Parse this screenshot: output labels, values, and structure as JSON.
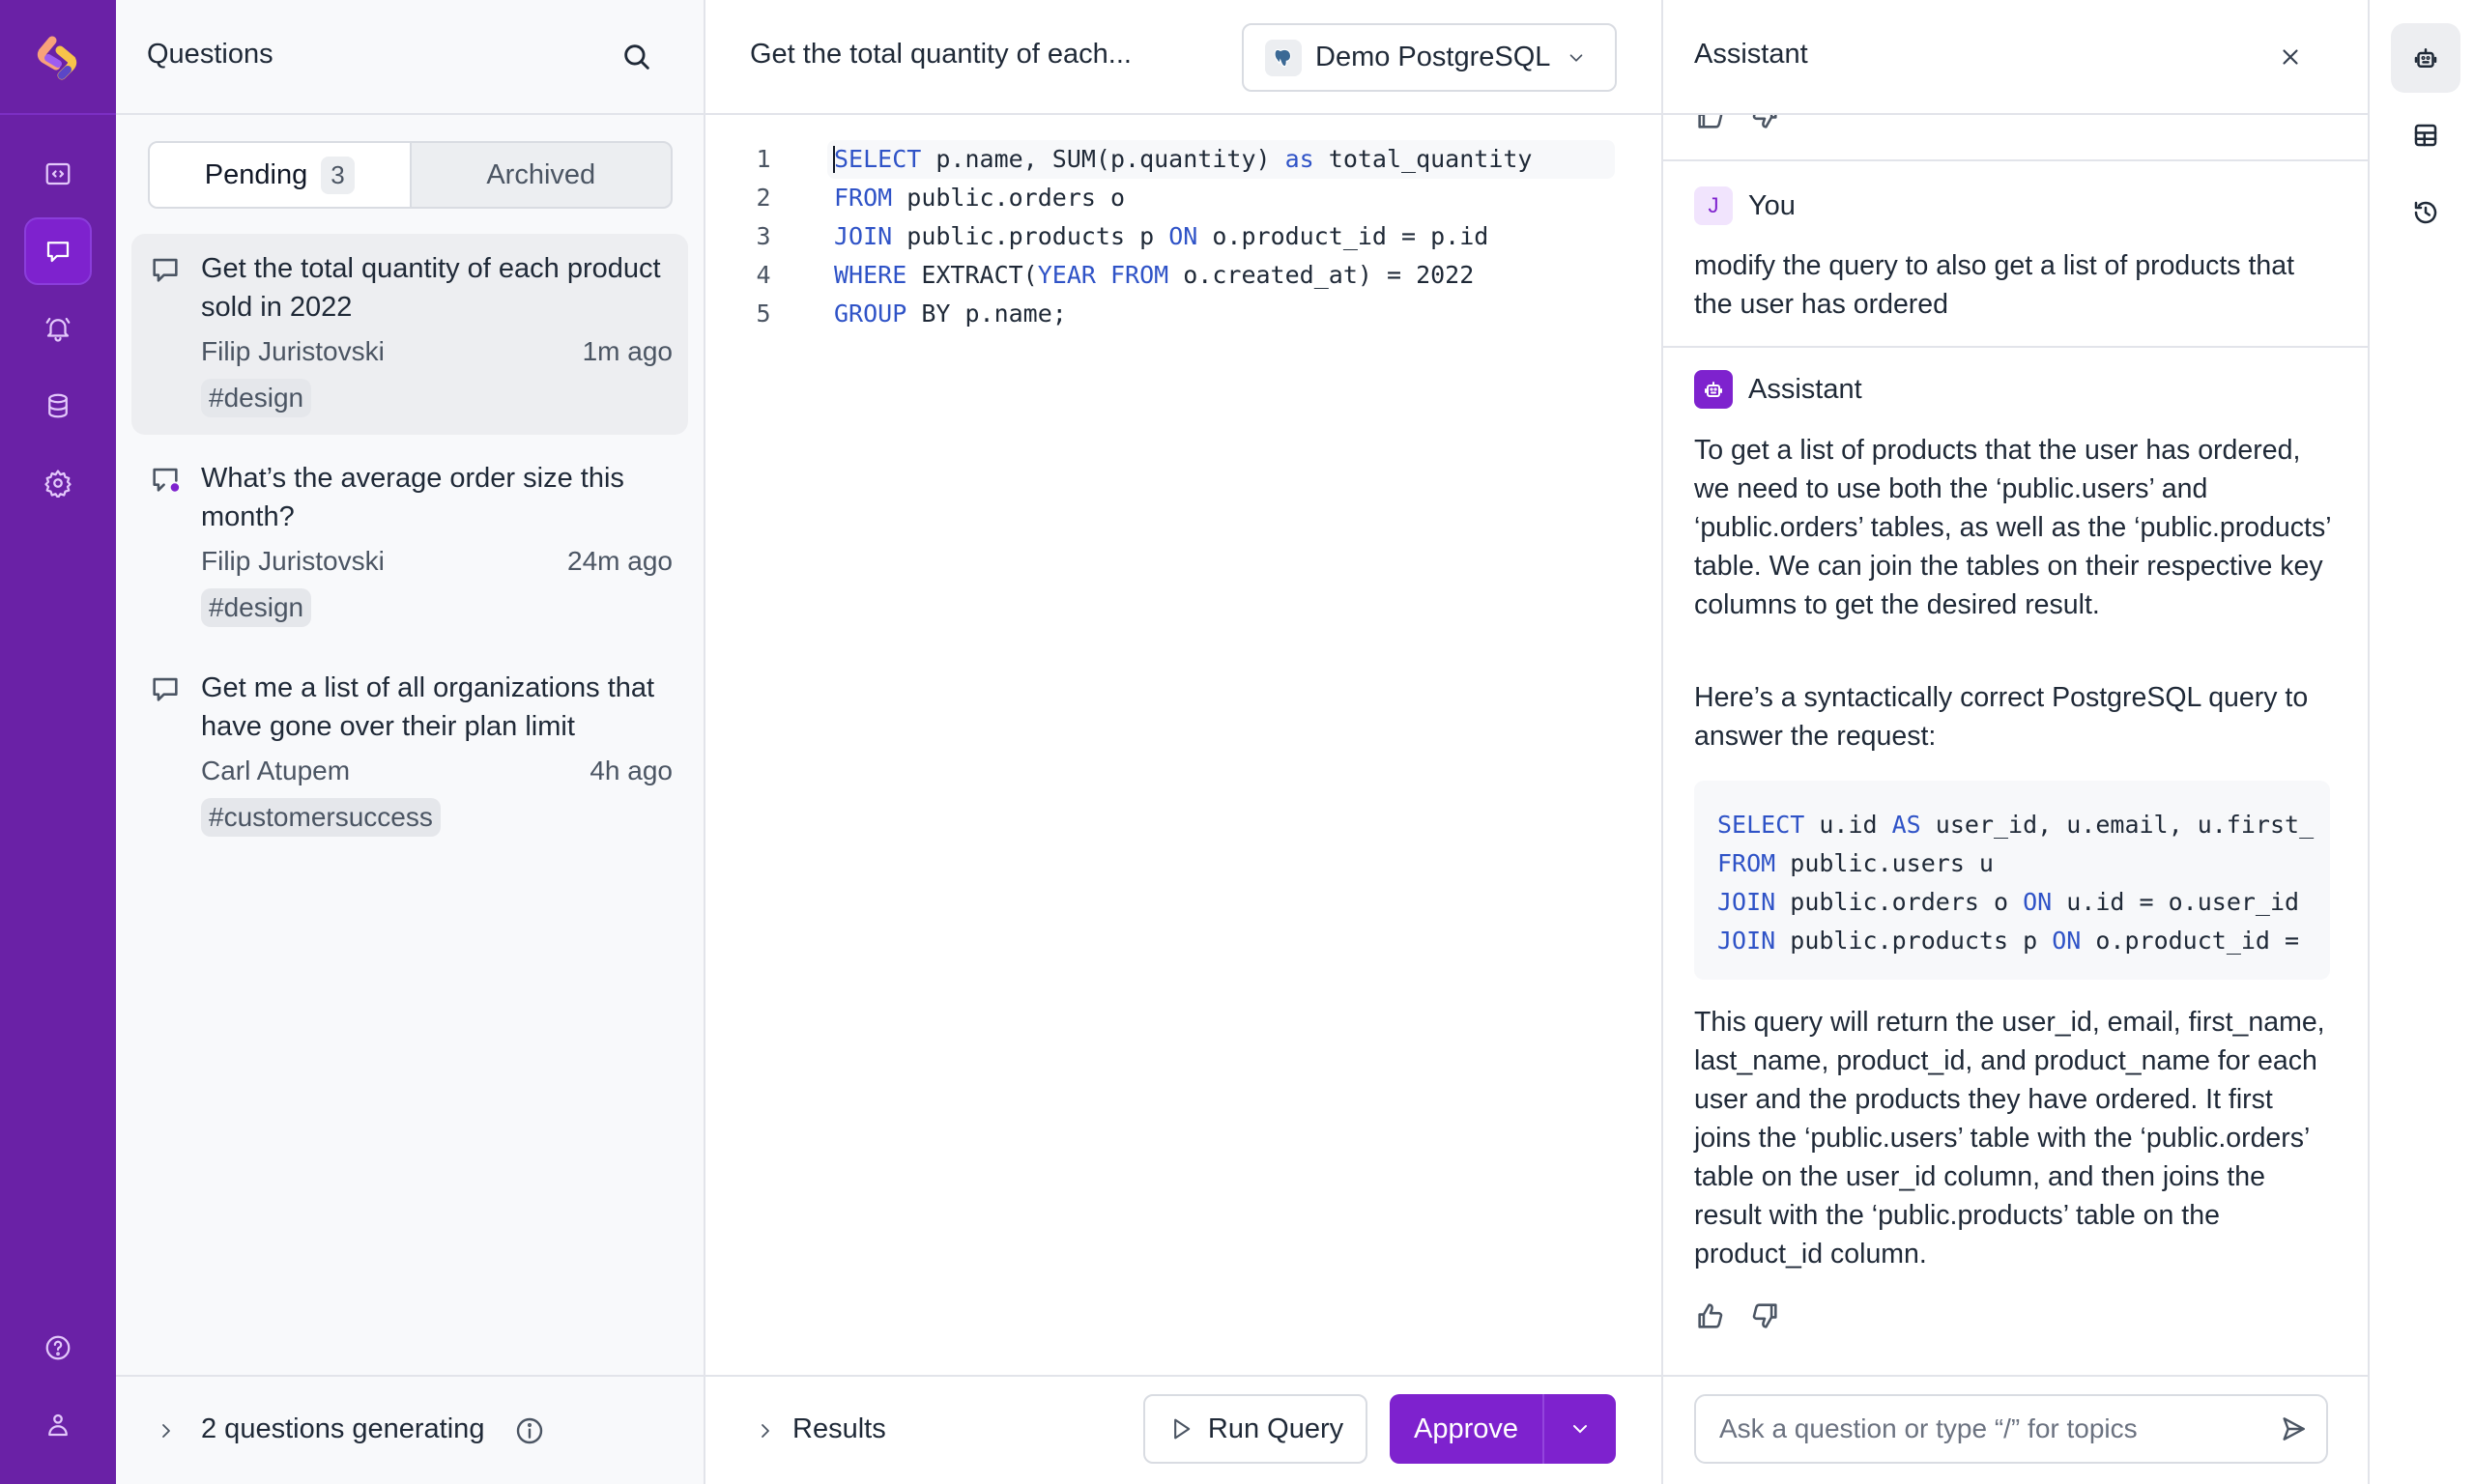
{
  "nav": {
    "items": [
      {
        "name": "editor",
        "icon": "code-window-icon"
      },
      {
        "name": "questions",
        "icon": "chat-bubble-icon",
        "active": true
      },
      {
        "name": "alerts",
        "icon": "bell-icon"
      },
      {
        "name": "databases",
        "icon": "database-icon"
      },
      {
        "name": "settings",
        "icon": "gear-icon"
      }
    ],
    "bottom": [
      {
        "name": "help",
        "icon": "help-circle-icon"
      },
      {
        "name": "profile",
        "icon": "user-icon"
      }
    ]
  },
  "questions": {
    "title": "Questions",
    "tabs": [
      {
        "label": "Pending",
        "count": "3",
        "active": true
      },
      {
        "label": "Archived"
      }
    ],
    "items": [
      {
        "text": "Get the total quantity of each product sold in 2022",
        "author": "Filip Juristovski",
        "time": "1m ago",
        "tag": "#design",
        "active": true,
        "unread": false
      },
      {
        "text": "What’s the average order size this month?",
        "author": "Filip Juristovski",
        "time": "24m ago",
        "tag": "#design",
        "active": false,
        "unread": true
      },
      {
        "text": "Get me a list of all organizations that have gone over their plan limit",
        "author": "Carl Atupem",
        "time": "4h ago",
        "tag": "#customersuccess",
        "active": false,
        "unread": false
      }
    ],
    "footer": {
      "label": "2 questions generating"
    }
  },
  "editor": {
    "title": "Get the total quantity of each...",
    "database": "Demo PostgreSQL",
    "code_lines": [
      [
        {
          "k": true,
          "t": "SELECT"
        },
        {
          "t": " p.name, SUM(p.quantity) "
        },
        {
          "k": true,
          "t": "as"
        },
        {
          "t": " total_quantity"
        }
      ],
      [
        {
          "k": true,
          "t": "FROM"
        },
        {
          "t": " public.orders o"
        }
      ],
      [
        {
          "k": true,
          "t": "JOIN"
        },
        {
          "t": " public.products p "
        },
        {
          "k": true,
          "t": "ON"
        },
        {
          "t": " o.product_id = p.id"
        }
      ],
      [
        {
          "k": true,
          "t": "WHERE"
        },
        {
          "t": " EXTRACT("
        },
        {
          "k": true,
          "t": "YEAR FROM"
        },
        {
          "t": " o.created_at) = 2022"
        }
      ],
      [
        {
          "k": true,
          "t": "GROUP"
        },
        {
          "t": " BY p.name;"
        }
      ]
    ],
    "footer": {
      "results_label": "Results",
      "run_label": "Run Query",
      "approve_label": "Approve"
    }
  },
  "assistant": {
    "title": "Assistant",
    "messages": [
      {
        "role": "user",
        "avatar": "J",
        "name": "You",
        "text": "modify the query to also get a list of products that the user has ordered"
      },
      {
        "role": "assistant",
        "name": "Assistant",
        "intro": "To get a list of products that the user has ordered, we need to use both the ‘public.users’ and ‘public.orders’ tables, as well as the ‘public.products’ table. We can join the tables on their respective key columns to get the desired result.",
        "lead": "Here’s a syntactically correct PostgreSQL query to answer the request:",
        "code_lines": [
          [
            {
              "k": true,
              "t": "SELECT"
            },
            {
              "t": " u.id "
            },
            {
              "k": true,
              "t": "AS"
            },
            {
              "t": " user_id, u.email, u.first_"
            }
          ],
          [
            {
              "k": true,
              "t": "FROM"
            },
            {
              "t": " public.users u"
            }
          ],
          [
            {
              "k": true,
              "t": "JOIN"
            },
            {
              "t": " public.orders o "
            },
            {
              "k": true,
              "t": "ON"
            },
            {
              "t": " u.id = o.user_id"
            }
          ],
          [
            {
              "k": true,
              "t": "JOIN"
            },
            {
              "t": " public.products p "
            },
            {
              "k": true,
              "t": "ON"
            },
            {
              "t": " o.product_id = "
            }
          ]
        ],
        "outro": "This query will return the user_id, email, first_name, last_name, product_id, and product_name for each user and the products they have ordered. It first joins the ‘public.users’ table with the ‘public.orders’ table on the user_id column, and then joins the result with the ‘public.products’ table on the product_id column."
      }
    ],
    "input": {
      "placeholder": "Ask a question or type “/” for topics",
      "value": ""
    }
  },
  "rail": {
    "items": [
      {
        "name": "assistant",
        "icon": "robot-icon",
        "active": true
      },
      {
        "name": "tables",
        "icon": "table-icon"
      },
      {
        "name": "history",
        "icon": "history-icon"
      }
    ]
  },
  "colors": {
    "brand_purple": "#6a21a6",
    "accent": "#7e22ce",
    "keyword": "#2f53c7"
  }
}
